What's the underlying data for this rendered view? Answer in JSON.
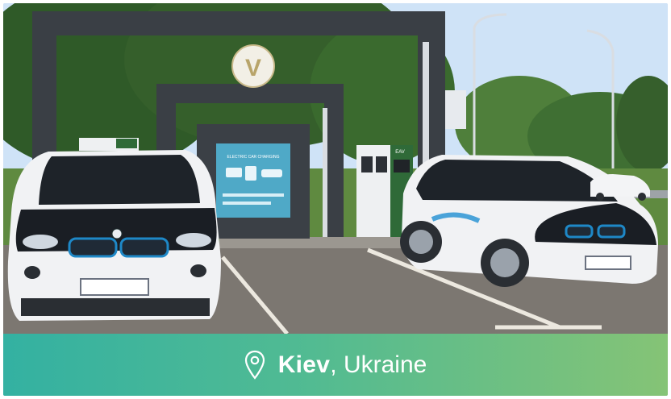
{
  "location": {
    "city": "Kiev",
    "separator": ", ",
    "country": "Ukraine"
  },
  "icons": {
    "pin": "location-pin-icon"
  },
  "signage": {
    "charger_brand": "EAV",
    "poster_title": "ELECTRIC CAR CHARGING",
    "logo_letter": "V"
  },
  "colors": {
    "caption_gradient_start": "#1eaa96",
    "caption_gradient_end": "#78be5f",
    "sky": "#cfe3f7",
    "asphalt": "#7c7771",
    "station_frame": "#3a3f45"
  }
}
